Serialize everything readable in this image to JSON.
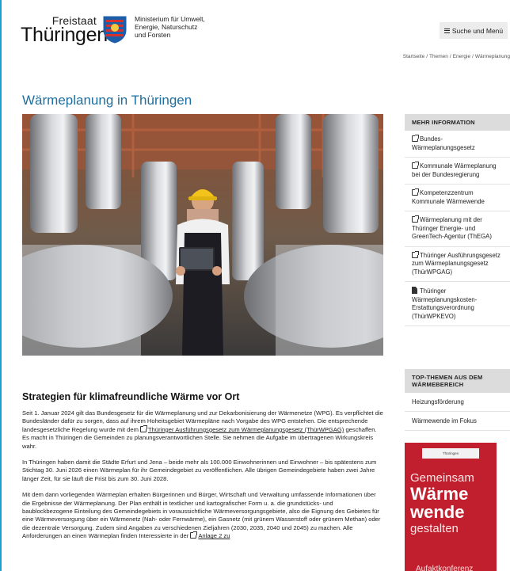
{
  "header": {
    "logo_small": "Freistaat",
    "logo_big": "Thüringen",
    "ministry": [
      "Ministerium für Umwelt,",
      "Energie, Naturschutz",
      "und Forsten"
    ],
    "menu_label": "Suche und Menü"
  },
  "breadcrumb": [
    "Startseite",
    "Themen",
    "Energie",
    "Wärmeplanung"
  ],
  "page_title": "Wärmeplanung in Thüringen",
  "sidebar": {
    "more_info_title": "MEHR INFORMATION",
    "links": [
      {
        "label": "Bundes-Wärmeplanungsgesetz",
        "icon": "external-link-icon"
      },
      {
        "label": "Kommunale Wärmeplanung bei der Bundesregierung",
        "icon": "external-link-icon"
      },
      {
        "label": "Kompetenzzentrum Kommunale Wärmewende",
        "icon": "external-link-icon"
      },
      {
        "label": "Wärmeplanung mit der Thüringer Energie- und GreenTech-Agentur (ThEGA)",
        "icon": "external-link-icon"
      },
      {
        "label": "Thüringer Ausführungsgesetz zum Wärmeplanungsgesetz (ThürWPGAG)",
        "icon": "external-link-icon"
      },
      {
        "label": "Thüringer Wärmeplanungskosten-Erstattungsverordnung (ThürWPKEVO)",
        "icon": "pdf-icon"
      }
    ],
    "top_title": "TOP-THEMEN AUS DEM WÄRMEBEREICH",
    "top_links": [
      "Heizungsförderung",
      "Wärmewende im Fokus"
    ]
  },
  "promo": {
    "logo": "Thüringen",
    "line1": "Gemeinsam",
    "line2": "Wärme",
    "line3": "wende",
    "line4": "gestalten",
    "line5": "Aufaktkonferenz"
  },
  "article": {
    "heading": "Strategien für klimafreundliche Wärme vor Ort",
    "p1_a": "Seit 1. Januar 2024 gilt das Bundesgesetz für die Wärmeplanung und zur Dekarbonisierung der Wärmenetze (WPG). Es verpflichtet die Bundesländer dafür zu sorgen, dass auf ihrem Hoheitsgebiet Wärmepläne nach Vorgabe des WPG entstehen. Die entsprechende landesgesetzliche Regelung wurde mit dem ",
    "p1_link": "Thüringer Ausführungsgesetz zum Wärmeplanungsgesetz (ThürWPGAG)",
    "p1_b": " geschaffen. Es macht in Thüringen die Gemeinden zu planungsverantwortlichen Stelle. Sie nehmen die Aufgabe im übertragenen Wirkungskreis wahr.",
    "p2": "In Thüringen haben damit die Städte Erfurt und Jena – beide mehr als 100.000 Einwohnerinnen und Einwohner – bis spätestens zum Stichtag 30. Juni 2026 einen Wärmeplan für ihr Gemeindegebiet zu veröffentlichen. Alle übrigen Gemeindegebiete haben zwei Jahre länger Zeit, für sie läuft die Frist bis zum 30. Juni 2028.",
    "p3_a": "Mit dem dann vorliegenden Wärmeplan erhalten Bürgerinnen und Bürger, Wirtschaft und Verwaltung umfassende Informationen über die Ergebnisse der Wärmeplanung. Der Plan enthält in textlicher und kartografischer Form u. a. die grundstücks- und baublockbezogene Einteilung des Gemeindegebiets in voraussichtliche Wärmeversorgungsgebiete, also die Eignung des Gebietes für eine Wärmeversorgung über ein Wärmenetz (Nah- oder Fernwärme), ein Gasnetz (mit grünem Wasserstoff oder grünem Methan) oder die dezentrale Versorgung. Zudem sind Angaben zu verschiedenen Zieljahren (2030, 2035, 2040 und 2045) zu machen. Alle Anforderungen an einen Wärmeplan finden Interessierte in der ",
    "p3_link": "Anlage 2 zu"
  }
}
